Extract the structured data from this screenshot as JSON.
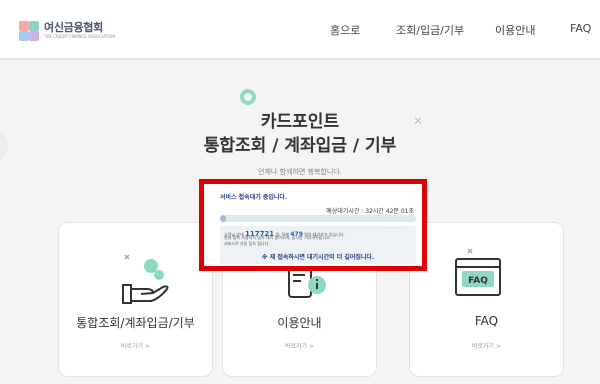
{
  "header": {
    "logo_title": "여신금융협회",
    "logo_subtitle": "THE CREDIT FINANCE ASSOCIATION",
    "nav": [
      "홈으로",
      "조회/입금/기부",
      "이용안내",
      "FAQ"
    ]
  },
  "hero": {
    "title_line1": "카드포인트",
    "title_line2": "통합조회 / 계좌입금 / 기부",
    "subtitle": "언제나 함께하면 행복합니다."
  },
  "cards": [
    {
      "title": "통합조회/계좌입금/기부",
      "link": "바로가기 >",
      "icon": "coin-hand-icon"
    },
    {
      "title": "이용안내",
      "link": "바로가기 >",
      "icon": "info-icon"
    },
    {
      "title": "FAQ",
      "link": "바로가기 >",
      "icon": "faq-icon"
    }
  ],
  "popup": {
    "title": "서비스 접속대기 중입니다.",
    "wait_time": "예상대기시간 : 32시간 42분 01초",
    "progress": 0.03,
    "queue_prefix": "고객님 앞에",
    "queue_ahead": "117721",
    "queue_mid": "명, 뒤에",
    "queue_behind": "479",
    "queue_suffix": "명의 대기자가 있습니다.",
    "line2": "현재 접속 사용자가 많아 대기 중이오며, 잠시만 기다려주십시오.",
    "line3": "서비스로 자동 접속 됩니다.",
    "note": "※ 재 접속하시면 대기시간이 더 길어집니다.",
    "accent": "#e10000"
  }
}
